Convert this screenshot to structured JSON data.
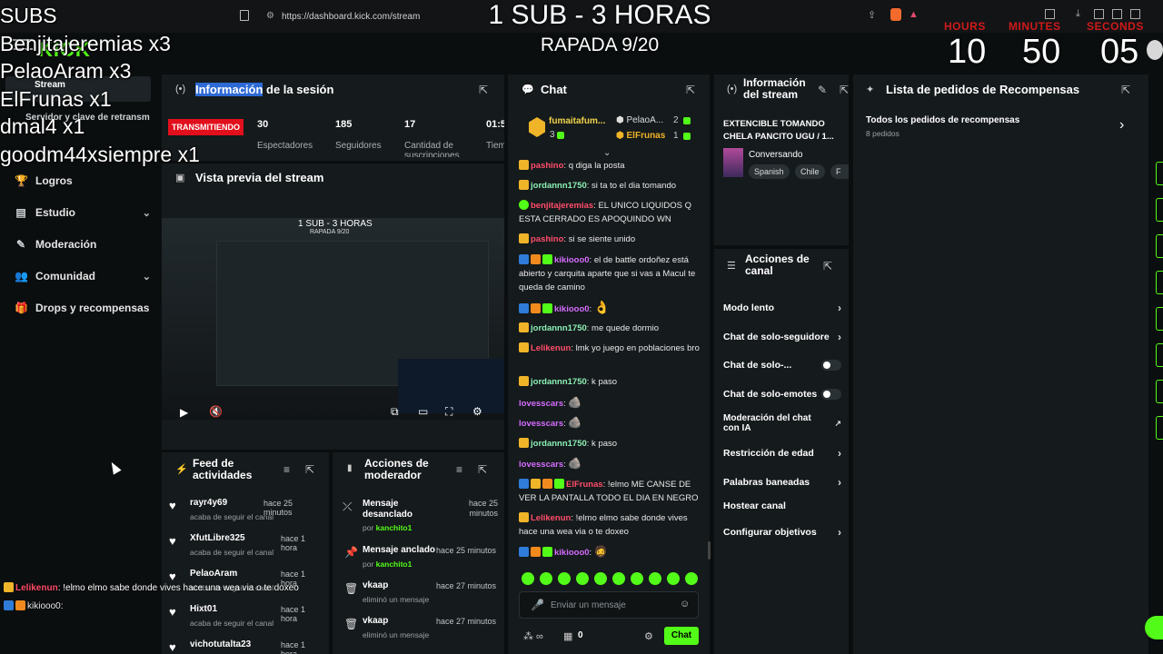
{
  "browser": {
    "url": "https://dashboard.kick.com/stream"
  },
  "overlay": {
    "title": "1 SUB - 3 HORAS",
    "subtitle": "RAPADA 9/20",
    "timer": {
      "hours_label": "HOURS",
      "minutes_label": "MINUTES",
      "seconds_label": "SECONDS",
      "hours": "10",
      "minutes": "50",
      "seconds": "05"
    },
    "subs_heading": "SUBS",
    "subs": [
      "Benjitajeremias x3",
      "PelaoAram x3",
      "ElFrunas x1",
      "dmal4 x1",
      "goodm44xsiempre x1"
    ]
  },
  "sidebar": {
    "items": [
      {
        "label": "Stream"
      },
      {
        "label": "Servidor y clave de retransm"
      },
      {
        "label": "Logros"
      },
      {
        "label": "Estudio"
      },
      {
        "label": "Moderación"
      },
      {
        "label": "Comunidad"
      },
      {
        "label": "Drops y recompensas"
      }
    ]
  },
  "session": {
    "title_highlight": "Información",
    "title_rest": " de la sesión",
    "live_badge": "TRANSMITIENDO",
    "stats": [
      {
        "value": "30",
        "label": "Espectadores"
      },
      {
        "value": "185",
        "label": "Seguidores"
      },
      {
        "value": "17",
        "label": "Cantidad de suscripciones"
      },
      {
        "value": "01:5",
        "label": "Tiem"
      }
    ]
  },
  "preview": {
    "title": "Vista previa del stream"
  },
  "feed": {
    "title": "Feed de actividades",
    "items": [
      {
        "name": "rayr4y69",
        "time": "hace 25 minutos",
        "desc": "acaba de seguir el canal"
      },
      {
        "name": "XfutLibre325",
        "time": "hace 1 hora",
        "desc": "acaba de seguir el canal"
      },
      {
        "name": "PelaoAram",
        "time": "hace 1 hora",
        "desc": "acaba de seguir el canal"
      },
      {
        "name": "Hixt01",
        "time": "hace 1 hora",
        "desc": "acaba de seguir el canal"
      },
      {
        "name": "vichotutalta23",
        "time": "hace 1 hora",
        "desc": ""
      }
    ]
  },
  "mod_actions": {
    "title": "Acciones de moderador",
    "items": [
      {
        "action": "Mensaje desanclado",
        "by": "por",
        "mod": "kanchito1",
        "time": "hace 25 minutos"
      },
      {
        "action": "Mensaje anclado",
        "by": "por",
        "mod": "kanchito1",
        "time": "hace 25 minutos"
      },
      {
        "action": "vkaap",
        "sub": "eliminó un mensaje",
        "time": "hace 27 minutos"
      },
      {
        "action": "vkaap",
        "sub": "eliminó un mensaje",
        "time": "hace 27 minutos"
      }
    ]
  },
  "chat": {
    "title": "Chat",
    "top_gifters": [
      {
        "name": "fumaitafum...",
        "count": "3"
      },
      {
        "name": "PelaoA...",
        "count": "2"
      },
      {
        "name": "ElFrunas",
        "count": "1"
      }
    ],
    "messages": [
      {
        "user": "pashino",
        "color": "r",
        "text": ": q diga la posta"
      },
      {
        "user": "jordannn1750",
        "color": "g",
        "text": ": si ta to el dia tomando"
      },
      {
        "user": "benjitajeremias",
        "color": "r",
        "text": ": EL UNICO LIQUIDOS Q ESTA CERRADO ES APOQUINDO WN"
      },
      {
        "user": "pashino",
        "color": "r",
        "text": ": si se siente unido"
      },
      {
        "user": "kikiooo0",
        "color": "p",
        "text": ": el de battle ordoñez está abierto y carquita aparte que si vas a Macul te queda de camino"
      },
      {
        "user": "kikiooo0",
        "color": "p",
        "text": ":"
      },
      {
        "user": "jordannn1750",
        "color": "g",
        "text": ": me quede dormio"
      },
      {
        "user": "Lelikenun",
        "color": "r",
        "text": ": lmk yo juego en poblaciones bro"
      },
      {
        "user": "jordannn1750",
        "color": "g",
        "text": ": k paso"
      },
      {
        "user": "lovesscars",
        "color": "p",
        "text": ":"
      },
      {
        "user": "lovesscars",
        "color": "p",
        "text": ":"
      },
      {
        "user": "jordannn1750",
        "color": "g",
        "text": ": k paso"
      },
      {
        "user": "lovesscars",
        "color": "p",
        "text": ":"
      },
      {
        "user": "ElFrunas",
        "color": "r",
        "text": ": !elmo ME CANSE DE VER LA PANTALLA TODO EL DIA EN NEGRO"
      },
      {
        "user": "Lelikenun",
        "color": "r",
        "text": ": !elmo elmo sabe donde vives hace una wea via o te doxeo"
      },
      {
        "user": "kikiooo0",
        "color": "p",
        "text": ":"
      }
    ],
    "input_placeholder": "Enviar un mensaje",
    "points": "0",
    "send_label": "Chat"
  },
  "stream_info": {
    "title": "Información del stream",
    "stream_title": "EXTENCIBLE TOMANDO CHELA PANCITO UGU / 1...",
    "category": "Conversando",
    "tags": [
      "Spanish",
      "Chile",
      "F"
    ]
  },
  "channel_actions": {
    "title": "Acciones de canal",
    "items": [
      {
        "label": "Modo lento",
        "kind": "chevron"
      },
      {
        "label": "Chat de solo-seguidore",
        "kind": "chevron"
      },
      {
        "label": "Chat de solo-...",
        "kind": "toggle"
      },
      {
        "label": "Chat de solo-emotes",
        "kind": "toggle"
      },
      {
        "label": "Moderación del chat con IA",
        "kind": "external"
      },
      {
        "label": "Restricción de edad",
        "kind": "chevron"
      },
      {
        "label": "Palabras baneadas",
        "kind": "chevron"
      },
      {
        "label": "Hostear canal",
        "kind": "none"
      },
      {
        "label": "Configurar objetivos",
        "kind": "chevron"
      }
    ]
  },
  "rewards": {
    "title": "Lista de pedidos de Recompensas",
    "all_label": "Todos los pedidos de recompensas",
    "count_label": "8 pedidos"
  },
  "bottom_overlay_chat": [
    {
      "user": "Lelikenun",
      "text": ": !elmo elmo sabe donde vives hace una wea via o te doxeo"
    },
    {
      "user": "kikiooo0",
      "text": ":"
    }
  ]
}
